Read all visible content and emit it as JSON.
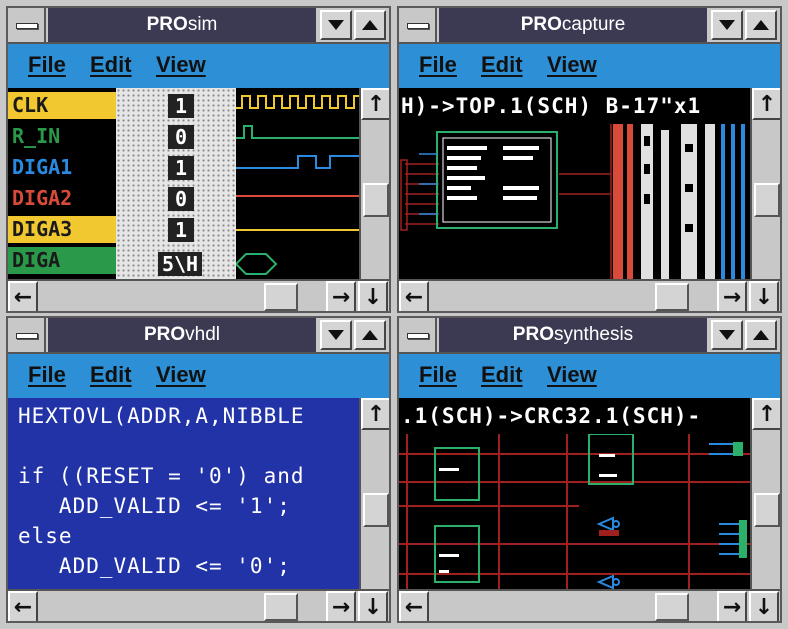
{
  "windows": [
    {
      "id": "prosim",
      "title_bold": "PRO",
      "title_rest": "sim"
    },
    {
      "id": "procapture",
      "title_bold": "PRO",
      "title_rest": "capture"
    },
    {
      "id": "provhdl",
      "title_bold": "PRO",
      "title_rest": "vhdl"
    },
    {
      "id": "prosynthesis",
      "title_bold": "PRO",
      "title_rest": "synthesis"
    }
  ],
  "menu": {
    "file": "File",
    "edit": "Edit",
    "view": "View"
  },
  "scroll": {
    "up": "↑",
    "down": "↓",
    "left": "←",
    "right": "→"
  },
  "prosim": {
    "signals": [
      {
        "name": "CLK",
        "value": "1",
        "name_color": "#1a1a1a",
        "bg": "#f2c830"
      },
      {
        "name": "R_IN",
        "value": "0",
        "name_color": "#2a9a4a",
        "bg": "#000000"
      },
      {
        "name": "DIGA1",
        "value": "1",
        "name_color": "#2a8ae0",
        "bg": "#000000"
      },
      {
        "name": "DIGA2",
        "value": "0",
        "name_color": "#d84a3a",
        "bg": "#000000"
      },
      {
        "name": "DIGA3",
        "value": "1",
        "name_color": "#1a1a1a",
        "bg": "#f2c830"
      },
      {
        "name": "DIGA",
        "value": "5\\H",
        "name_color": "#1a1a1a",
        "bg": "#2a9a4a"
      }
    ]
  },
  "procapture": {
    "path_text": "H)->TOP.1(SCH) B-17\"x1"
  },
  "provhdl": {
    "lines": [
      "HEXTOVL(ADDR,A,NIBBLE",
      "",
      "if ((RESET = '0') and",
      "   ADD_VALID <= '1';",
      "else",
      "   ADD_VALID <= '0';"
    ]
  },
  "prosynthesis": {
    "path_text": ".1(SCH)->CRC32.1(SCH)-"
  },
  "colors": {
    "menubar": "#2d8fd6",
    "titlebar": "#3b3a52",
    "code_bg": "#2233a8",
    "wire_red": "#a02020",
    "wire_blue": "#2a8ae0",
    "wire_green": "#2ab06a"
  }
}
